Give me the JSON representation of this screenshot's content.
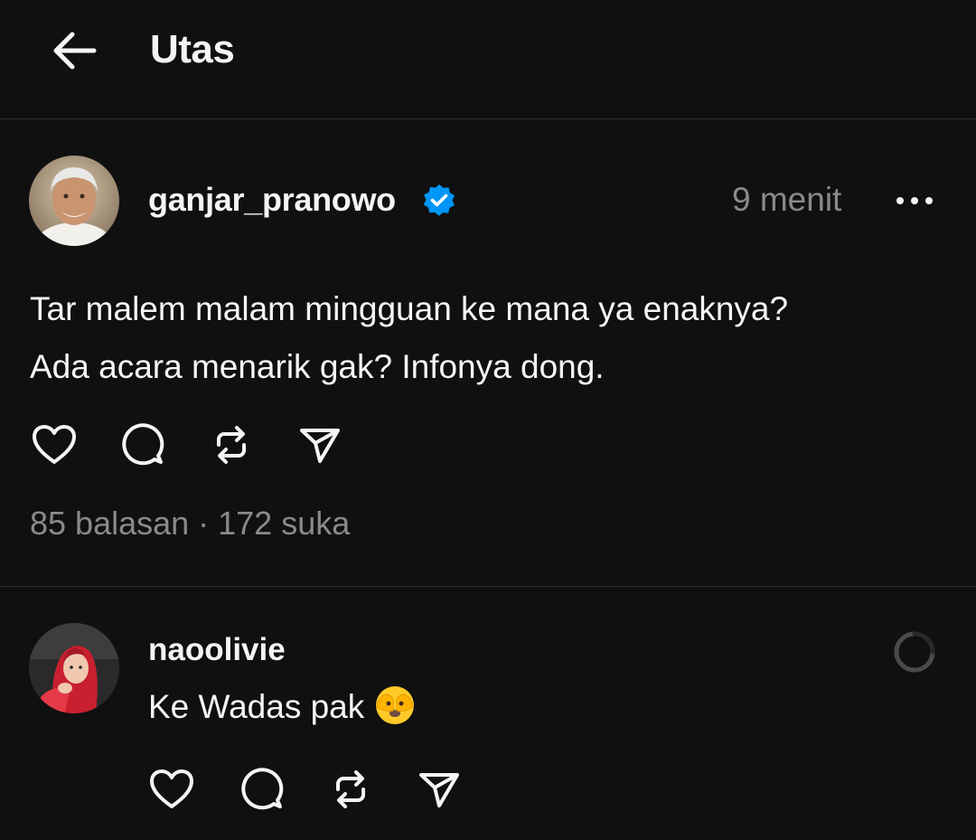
{
  "header": {
    "title": "Utas",
    "back_icon": "arrow-left-icon"
  },
  "post": {
    "username": "ganjar_pranowo",
    "verified": true,
    "verified_color": "#0095f6",
    "timestamp": "9 menit",
    "more_icon": "more-horizontal-icon",
    "text_line1": "Tar malem malam mingguan ke mana ya enaknya?",
    "text_line2": "Ada acara menarik gak? Infonya dong.",
    "actions": [
      "heart-icon",
      "comment-icon",
      "repost-icon",
      "share-icon"
    ],
    "stats": "85 balasan · 172 suka"
  },
  "reply": {
    "username": "naoolivie",
    "text": "Ke Wadas pak",
    "emoji": "face-with-peeking-eye-emoji",
    "status_icon": "loading-spinner-icon",
    "actions": [
      "heart-icon",
      "comment-icon",
      "repost-icon",
      "share-icon"
    ]
  },
  "colors": {
    "background": "#101010",
    "text_primary": "#f3f5f7",
    "text_secondary": "#8a8a8a",
    "divider": "#2e2e2e"
  }
}
